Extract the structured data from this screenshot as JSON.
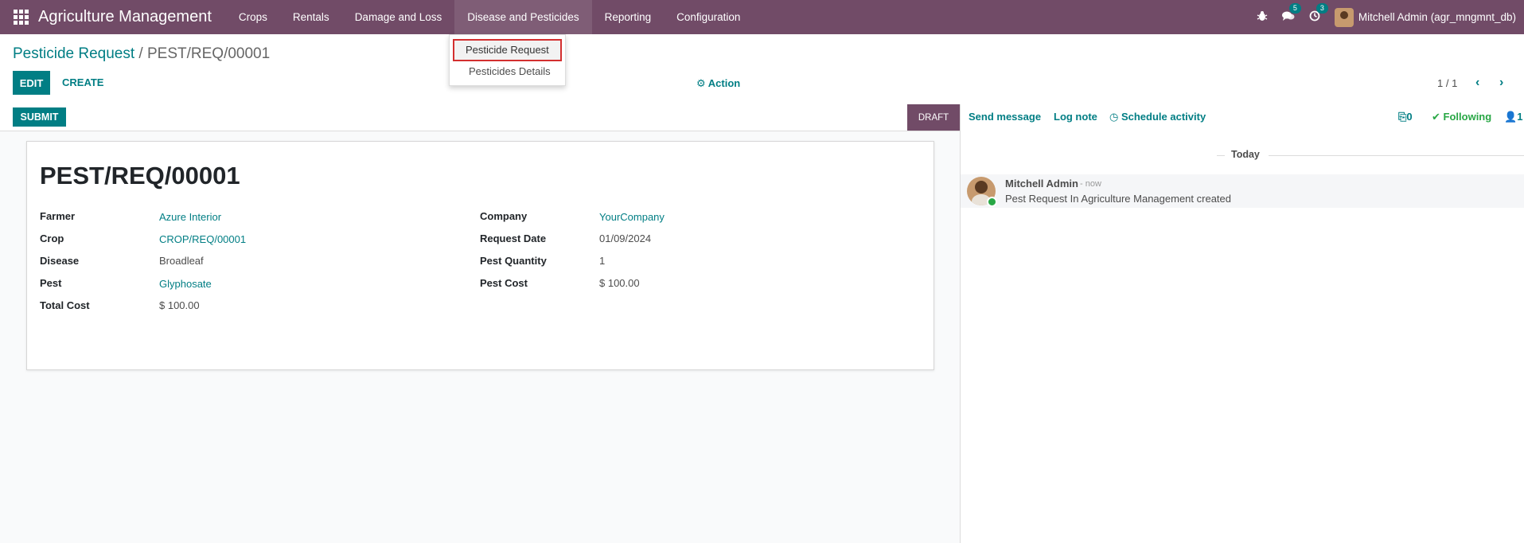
{
  "navbar": {
    "brand": "Agriculture Management",
    "menu": [
      "Crops",
      "Rentals",
      "Damage and Loss",
      "Disease and Pesticides",
      "Reporting",
      "Configuration"
    ],
    "messages_count": "5",
    "activities_count": "3",
    "user": "Mitchell Admin (agr_mngmnt_db)"
  },
  "dropdown": {
    "items": [
      "Pesticide Request",
      "Pesticides Details"
    ]
  },
  "control": {
    "breadcrumb_parent": "Pesticide Request",
    "breadcrumb_sep": " / ",
    "breadcrumb_current": "PEST/REQ/00001",
    "edit_label": "EDIT",
    "create_label": "CREATE",
    "action_label": "Action",
    "pager": "1 / 1"
  },
  "status": {
    "submit_label": "SUBMIT",
    "state": "DRAFT"
  },
  "form": {
    "title": "PEST/REQ/00001",
    "left": [
      {
        "label": "Farmer",
        "value": "Azure Interior"
      },
      {
        "label": "Crop",
        "value": "CROP/REQ/00001"
      },
      {
        "label": "Disease",
        "value": "Broadleaf"
      },
      {
        "label": "Pest",
        "value": "Glyphosate"
      },
      {
        "label": "Total Cost",
        "value": "$ 100.00"
      }
    ],
    "right": [
      {
        "label": "Company",
        "value": "YourCompany"
      },
      {
        "label": "Request Date",
        "value": "01/09/2024"
      },
      {
        "label": "Pest Quantity",
        "value": "1"
      },
      {
        "label": "Pest Cost",
        "value": "$ 100.00"
      }
    ]
  },
  "chatter": {
    "send_message": "Send message",
    "log_note": "Log note",
    "schedule_activity": "Schedule activity",
    "attachments": "0",
    "following": "Following",
    "followers": "1",
    "date_separator": "Today",
    "message": {
      "author": "Mitchell Admin",
      "time": "- now",
      "body": "Pest Request In Agriculture Management created"
    }
  }
}
